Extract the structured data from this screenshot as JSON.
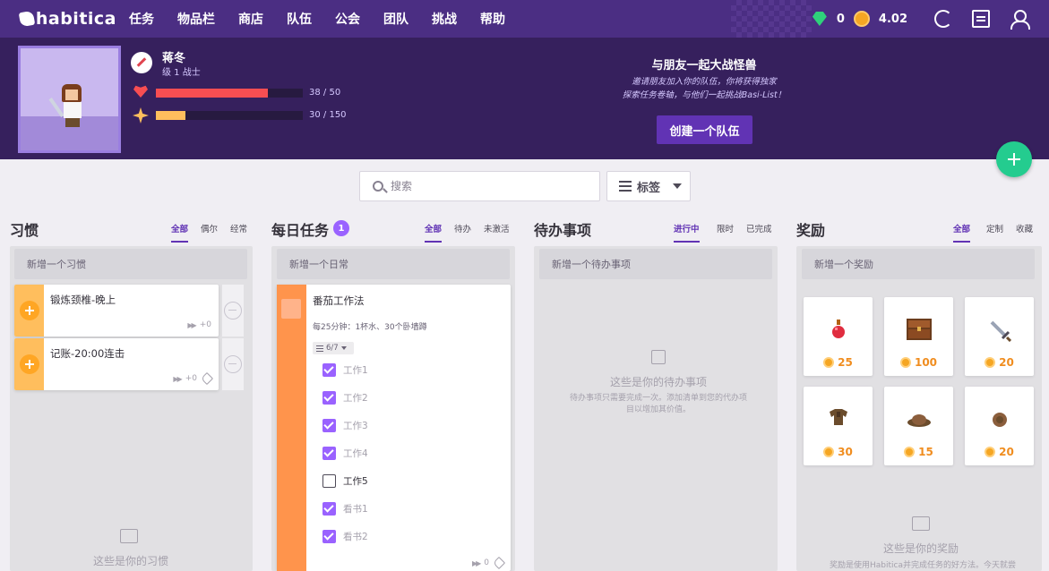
{
  "nav": {
    "logo": "habitica",
    "items": [
      "任务",
      "物品栏",
      "商店",
      "队伍",
      "公会",
      "团队",
      "挑战",
      "帮助"
    ],
    "gems": "0",
    "gold": "4.02"
  },
  "user": {
    "name": "蒋冬",
    "level": "级 1 战士",
    "hp_text": "38 / 50",
    "hp_fraction": 0.76,
    "xp_text": "30 / 150",
    "xp_fraction": 0.2
  },
  "party": {
    "title": "与朋友一起大战怪兽",
    "desc_line1": "邀请朋友加入你的队伍，你将获得独家",
    "desc_line2": "探索任务卷轴，与他们一起挑战Basi-List！",
    "button": "创建一个队伍"
  },
  "search": {
    "placeholder": "搜索",
    "tags_label": "标签"
  },
  "habits": {
    "title": "习惯",
    "tabs": [
      "全部",
      "偶尔",
      "经常"
    ],
    "add_placeholder": "新增一个习惯",
    "items": [
      {
        "title": "锻炼颈椎-晚上",
        "streak": "+0"
      },
      {
        "title": "记账-20:00连击",
        "streak": "+0"
      }
    ],
    "empty_title": "这些是你的习惯"
  },
  "dailies": {
    "title": "每日任务",
    "badge": "1",
    "tabs": [
      "全部",
      "待办",
      "未激活"
    ],
    "add_placeholder": "新增一个日常",
    "item": {
      "title": "番茄工作法",
      "notes": "每25分钟：1杯水、30个卧墙蹲",
      "checklist_count": "6/7",
      "checklist": [
        {
          "text": "工作1",
          "done": true
        },
        {
          "text": "工作2",
          "done": true
        },
        {
          "text": "工作3",
          "done": true
        },
        {
          "text": "工作4",
          "done": true
        },
        {
          "text": "工作5",
          "done": false
        },
        {
          "text": "看书1",
          "done": true
        },
        {
          "text": "看书2",
          "done": true
        }
      ],
      "streak": "0"
    }
  },
  "todos": {
    "title": "待办事项",
    "tabs": [
      "进行中",
      "限时",
      "已完成"
    ],
    "add_placeholder": "新增一个待办事项",
    "empty_title": "这些是你的待办事项",
    "empty_desc_line1": "待办事项只需要完成一次。添加清单到您的代办项",
    "empty_desc_line2": "目以增加其价值。"
  },
  "rewards": {
    "title": "奖励",
    "tabs": [
      "全部",
      "定制",
      "收藏"
    ],
    "add_placeholder": "新增一个奖励",
    "items": [
      {
        "icon": "health-potion-icon",
        "cost": "25"
      },
      {
        "icon": "treasure-chest-icon",
        "cost": "100"
      },
      {
        "icon": "sword-icon",
        "cost": "20"
      },
      {
        "icon": "armor-icon",
        "cost": "30"
      },
      {
        "icon": "helmet-icon",
        "cost": "15"
      },
      {
        "icon": "shield-icon",
        "cost": "20"
      }
    ],
    "empty_title": "这些是你的奖励",
    "empty_desc": "奖励是使用Habitica并完成任务的好方法。今天就尝"
  },
  "colors": {
    "nav_bg": "#4b2e83",
    "banner_bg": "#36205d",
    "accent": "#6133b4",
    "habit": "#ffbe5d",
    "daily": "#ff944c",
    "check": "#9a62ff",
    "add_fab": "#24cc8f"
  }
}
